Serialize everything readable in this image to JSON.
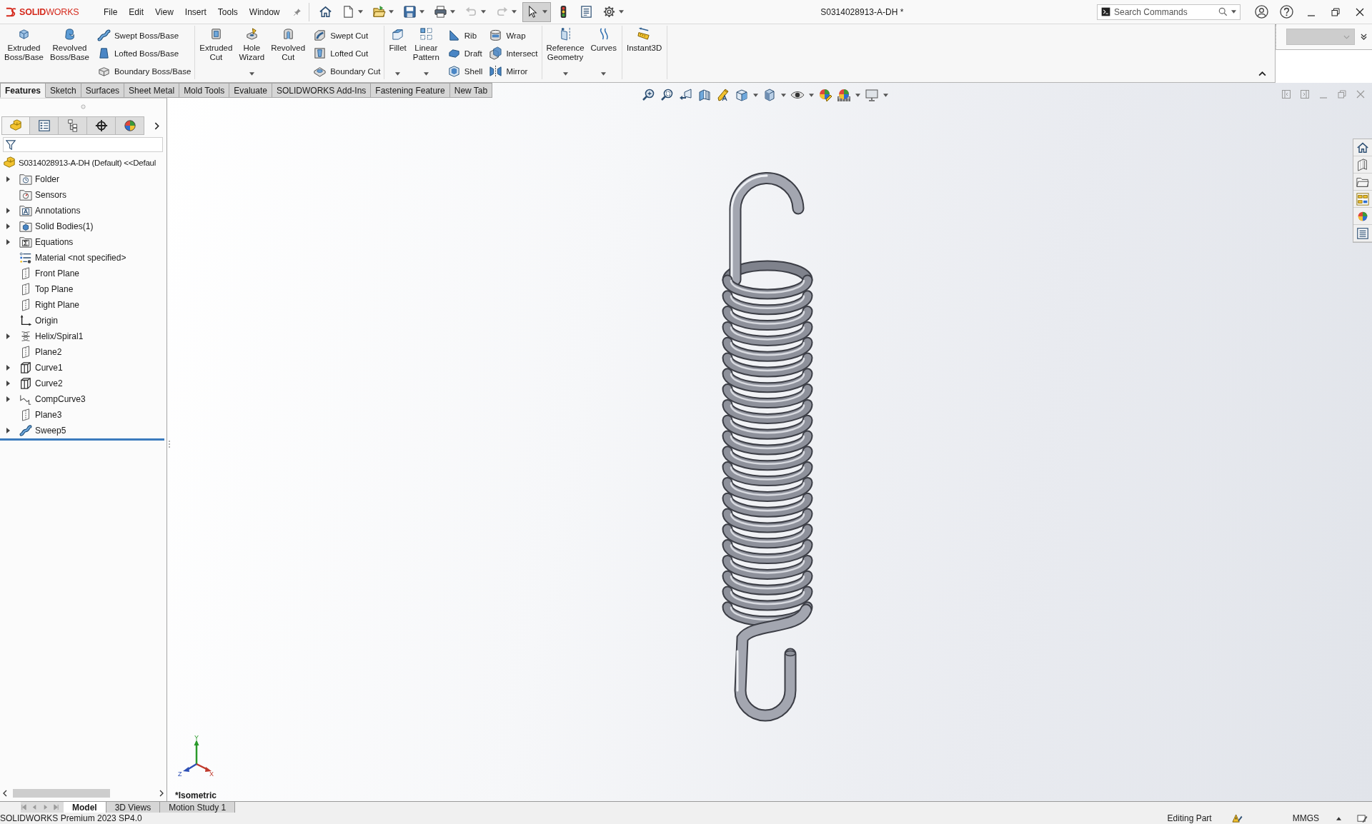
{
  "app": {
    "logo": "**SOLID**WORKS",
    "menus": [
      "File",
      "Edit",
      "View",
      "Insert",
      "Tools",
      "Window"
    ],
    "document_title": "S0314028913-A-DH *",
    "search": {
      "placeholder": "Search Commands"
    }
  },
  "quick_access": [
    {
      "has_menu": false,
      "disabled": false,
      "selected": false
    },
    {
      "has_menu": true,
      "disabled": false,
      "selected": false
    },
    {
      "has_menu": true,
      "disabled": false,
      "selected": false
    },
    {
      "has_menu": true,
      "disabled": false,
      "selected": false
    },
    {
      "has_menu": true,
      "disabled": false,
      "selected": false
    },
    {
      "has_menu": true,
      "disabled": true,
      "selected": false
    },
    {
      "has_menu": true,
      "disabled": true,
      "selected": false
    },
    {
      "has_menu": true,
      "disabled": false,
      "selected": true
    },
    {
      "has_menu": false,
      "disabled": false,
      "selected": false
    },
    {
      "has_menu": false,
      "disabled": false,
      "selected": false
    },
    {
      "has_menu": true,
      "disabled": false,
      "selected": false
    }
  ],
  "ribbon": {
    "groups": [
      {
        "stacks": [
          {
            "kind": "large",
            "label": "Extruded Boss/Base",
            "has_menu": false
          },
          {
            "kind": "large",
            "label": "Revolved Boss/Base",
            "has_menu": false
          },
          {
            "kind": "column",
            "items": [
              {
                "label": "Swept Boss/Base"
              },
              {
                "label": "Lofted Boss/Base"
              },
              {
                "label": "Boundary Boss/Base"
              }
            ]
          }
        ]
      },
      {
        "stacks": [
          {
            "kind": "large",
            "label": "Extruded Cut",
            "has_menu": false
          },
          {
            "kind": "large",
            "label": "Hole Wizard",
            "has_menu": true
          },
          {
            "kind": "large",
            "label": "Revolved Cut",
            "has_menu": false
          },
          {
            "kind": "column",
            "items": [
              {
                "label": "Swept Cut"
              },
              {
                "label": "Lofted Cut"
              },
              {
                "label": "Boundary Cut"
              }
            ]
          }
        ]
      },
      {
        "stacks": [
          {
            "kind": "large",
            "label": "Fillet",
            "has_menu": true
          },
          {
            "kind": "large",
            "label": "Linear Pattern",
            "has_menu": true
          },
          {
            "kind": "column",
            "items": [
              {
                "label": "Rib"
              },
              {
                "label": "Draft"
              },
              {
                "label": "Shell"
              }
            ]
          },
          {
            "kind": "column",
            "items": [
              {
                "label": "Wrap"
              },
              {
                "label": "Intersect"
              },
              {
                "label": "Mirror"
              }
            ]
          }
        ]
      },
      {
        "stacks": [
          {
            "kind": "large",
            "label": "Reference Geometry",
            "has_menu": true
          },
          {
            "kind": "large",
            "label": "Curves",
            "has_menu": true
          }
        ]
      },
      {
        "stacks": [
          {
            "kind": "large",
            "label": "Instant3D",
            "has_menu": false
          }
        ]
      }
    ]
  },
  "command_tabs": [
    {
      "label": "Features",
      "selected": true
    },
    {
      "label": "Sketch",
      "selected": false
    },
    {
      "label": "Surfaces",
      "selected": false
    },
    {
      "label": "Sheet Metal",
      "selected": false
    },
    {
      "label": "Mold Tools",
      "selected": false
    },
    {
      "label": "Evaluate",
      "selected": false
    },
    {
      "label": "SOLIDWORKS Add-Ins",
      "selected": false
    },
    {
      "label": "Fastening Feature",
      "selected": false
    },
    {
      "label": "New Tab",
      "selected": false
    }
  ],
  "feature_manager": {
    "panel_tabs": [
      {
        "selected": true
      },
      {
        "selected": false
      },
      {
        "selected": false
      },
      {
        "selected": false
      },
      {
        "selected": false
      }
    ],
    "tree": {
      "label": "S0314028913-A-DH (Default) <<Defaul",
      "children": [
        {
          "label": "Folder",
          "kind": "history-folder",
          "expandable": true,
          "expanded": false
        },
        {
          "label": "Sensors",
          "kind": "sensor-folder",
          "expandable": false,
          "expanded": false
        },
        {
          "label": "Annotations",
          "kind": "annotation-folder",
          "expandable": true,
          "expanded": false
        },
        {
          "label": "Solid Bodies(1)",
          "kind": "body-folder",
          "expandable": true,
          "expanded": false
        },
        {
          "label": "Equations",
          "kind": "equation-folder",
          "expandable": true,
          "expanded": false
        },
        {
          "label": "Material <not specified>",
          "kind": "material",
          "expandable": false,
          "expanded": false
        },
        {
          "label": "Front Plane",
          "kind": "plane",
          "expandable": false,
          "expanded": false
        },
        {
          "label": "Top Plane",
          "kind": "plane",
          "expandable": false,
          "expanded": false
        },
        {
          "label": "Right Plane",
          "kind": "plane",
          "expandable": false,
          "expanded": false
        },
        {
          "label": "Origin",
          "kind": "origin",
          "expandable": false,
          "expanded": false
        },
        {
          "label": "Helix/Spiral1",
          "kind": "helix",
          "expandable": true,
          "expanded": false
        },
        {
          "label": "Plane2",
          "kind": "plane",
          "expandable": false,
          "expanded": false
        },
        {
          "label": "Curve1",
          "kind": "curve",
          "expandable": true,
          "expanded": false
        },
        {
          "label": "Curve2",
          "kind": "curve",
          "expandable": true,
          "expanded": false
        },
        {
          "label": "CompCurve3",
          "kind": "composite-curve",
          "expandable": true,
          "expanded": false
        },
        {
          "label": "Plane3",
          "kind": "plane",
          "expandable": false,
          "expanded": false
        },
        {
          "label": "Sweep5",
          "kind": "sweep",
          "expandable": true,
          "expanded": false
        }
      ]
    }
  },
  "viewport": {
    "view_toolbar": [
      {
        "has_menu": false
      },
      {
        "has_menu": false
      },
      {
        "has_menu": false
      },
      {
        "has_menu": false
      },
      {
        "has_menu": false
      },
      {
        "has_menu": true
      },
      {
        "has_menu": true
      },
      {
        "has_menu": true
      },
      {
        "has_menu": false
      },
      {
        "has_menu": true
      },
      {
        "has_menu": true
      }
    ],
    "triad": {
      "x": "X",
      "y": "Y",
      "z": "Z"
    },
    "view_name": "*Isometric"
  },
  "bottom_tabs": [
    {
      "label": "Model",
      "selected": true
    },
    {
      "label": "3D Views",
      "selected": false
    },
    {
      "label": "Motion Study 1",
      "selected": false
    }
  ],
  "status_bar": {
    "product": "SOLIDWORKS Premium 2023 SP4.0",
    "mode": "Editing Part",
    "units": "MMGS"
  }
}
